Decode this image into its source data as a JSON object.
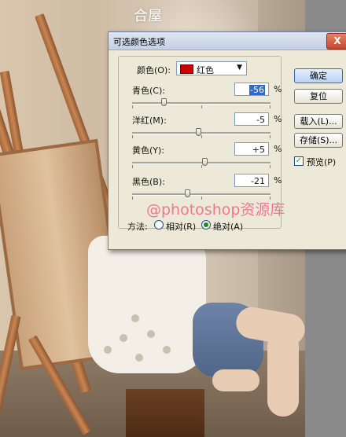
{
  "background": {
    "logo_text": "合屋"
  },
  "dialog": {
    "title": "可选颜色选项",
    "close_label": "X",
    "colors_label": "颜色(O):",
    "color_value": "红色",
    "color_swatch": "#cc0000",
    "sliders": [
      {
        "label": "青色(C):",
        "value": "-56",
        "fraction": 0.23,
        "selected": true
      },
      {
        "label": "洋红(M):",
        "value": "-5",
        "fraction": 0.475
      },
      {
        "label": "黄色(Y):",
        "value": "+5",
        "fraction": 0.525
      },
      {
        "label": "黑色(B):",
        "value": "-21",
        "fraction": 0.395
      }
    ],
    "percent": "%",
    "buttons": {
      "ok": "确定",
      "reset": "复位",
      "load": "载入(L)...",
      "save": "存储(S)..."
    },
    "preview_label": "预览(P)",
    "preview_checked": true,
    "method_label": "方法:",
    "method_relative": "相对(R)",
    "method_absolute": "绝对(A)",
    "method_selected": "absolute"
  },
  "watermark": "@photoshop资源库"
}
